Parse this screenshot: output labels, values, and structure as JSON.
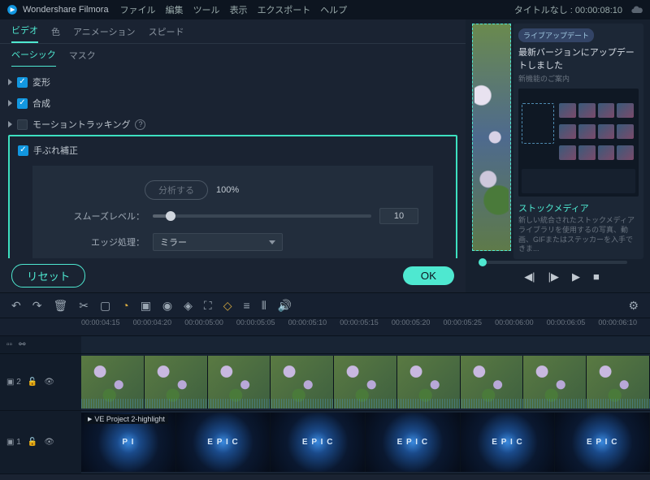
{
  "titlebar": {
    "brand": "Wondershare Filmora",
    "menus": [
      "ファイル",
      "編集",
      "ツール",
      "表示",
      "エクスポート",
      "ヘルプ"
    ],
    "status": "タイトルなし : 00:00:08:10"
  },
  "tabs1": {
    "video": "ビデオ",
    "color": "色",
    "anim": "アニメーション",
    "speed": "スピード",
    "active": "video"
  },
  "tabs2": {
    "basic": "ベーシック",
    "mask": "マスク",
    "active": "basic"
  },
  "props": {
    "transform": "変形",
    "compose": "合成",
    "motion_tracking": "モーショントラッキング",
    "stabilization": "手ぶれ補正",
    "analyze_label": "分析する",
    "analyze_pct": "100%",
    "smooth_label": "スムーズレベル：",
    "smooth_value": "10",
    "edge_label": "エッジ処理：",
    "edge_value": "ミラー"
  },
  "buttons": {
    "reset": "リセット",
    "ok": "OK"
  },
  "promo": {
    "tag": "ライブアップデート",
    "title": "最新バージョンにアップデートしました",
    "subtitle": "新機能のご案内",
    "h2": "ストックメディア",
    "desc": "新しい統合されたストックメディアライブラリを使用するの写真、動画、GIFまたはステッカーを入手できま..."
  },
  "timeline": {
    "marks": [
      "00:00:04:15",
      "00:00:04:20",
      "00:00:05:00",
      "00:00:05:05",
      "00:00:05:10",
      "00:00:05:15",
      "00:00:05:20",
      "00:00:05:25",
      "00:00:06:00",
      "00:00:06:05",
      "00:00:06:10"
    ],
    "track2_head": "▣ 2",
    "track3_head": "▣ 1",
    "clip_label": "VE Project 2-highlight"
  }
}
